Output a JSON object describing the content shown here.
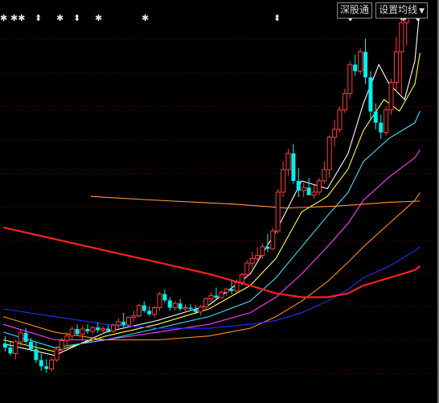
{
  "toolbar": {
    "shenzhen_label": "深股通",
    "set_ma_label": "设置均线",
    "dropdown_icon": "chevron-down-icon"
  },
  "markers": [
    "✱",
    "✱✱",
    "⬍",
    "✱",
    "⬍",
    "✱",
    "✱",
    "⬍",
    "⬍",
    "✱",
    "⬍"
  ],
  "colors": {
    "background": "#000000",
    "up": "#ff3c3c",
    "down": "#00f0f0",
    "ma5": "#ffffff",
    "ma10": "#ffff40",
    "ma20": "#40e0ff",
    "ma30": "#ff40ff",
    "ma60": "#ff8c1a",
    "ma120": "#2030ff",
    "ma250": "#ff2020",
    "avg": "#ff9a40",
    "grid": "#a00000"
  },
  "chart_data": {
    "type": "candlestick",
    "y_axis": {
      "min": 0,
      "max": 100,
      "grid": "dotted"
    },
    "candles": [
      {
        "o": 13,
        "h": 15,
        "l": 11,
        "c": 12
      },
      {
        "o": 12,
        "h": 13.5,
        "l": 10,
        "c": 10.5
      },
      {
        "o": 10.5,
        "h": 14,
        "l": 9,
        "c": 13.5
      },
      {
        "o": 13.5,
        "h": 16.5,
        "l": 12.5,
        "c": 15.8
      },
      {
        "o": 15.8,
        "h": 17,
        "l": 13,
        "c": 13.5
      },
      {
        "o": 13.5,
        "h": 14.5,
        "l": 11,
        "c": 11.6
      },
      {
        "o": 11.6,
        "h": 13.5,
        "l": 8,
        "c": 8.8
      },
      {
        "o": 8.8,
        "h": 10.5,
        "l": 6,
        "c": 7.2
      },
      {
        "o": 7.2,
        "h": 9,
        "l": 5.5,
        "c": 6.5
      },
      {
        "o": 6.5,
        "h": 9.5,
        "l": 5.8,
        "c": 8.8
      },
      {
        "o": 8.8,
        "h": 12,
        "l": 8.3,
        "c": 11.6
      },
      {
        "o": 11.6,
        "h": 14.5,
        "l": 10.5,
        "c": 13.8
      },
      {
        "o": 13.8,
        "h": 16,
        "l": 12.4,
        "c": 15
      },
      {
        "o": 15,
        "h": 17.5,
        "l": 14.2,
        "c": 16.8
      },
      {
        "o": 16.8,
        "h": 18,
        "l": 15,
        "c": 15.5
      },
      {
        "o": 15.5,
        "h": 17.5,
        "l": 14,
        "c": 16.8
      },
      {
        "o": 16.8,
        "h": 18,
        "l": 15.5,
        "c": 16.2
      },
      {
        "o": 16.2,
        "h": 17.5,
        "l": 15.5,
        "c": 17.2
      },
      {
        "o": 17.2,
        "h": 18.5,
        "l": 15.8,
        "c": 16.5
      },
      {
        "o": 16.5,
        "h": 17.5,
        "l": 15.5,
        "c": 16.9
      },
      {
        "o": 16.9,
        "h": 17.8,
        "l": 15.8,
        "c": 16.3
      },
      {
        "o": 16.3,
        "h": 18.2,
        "l": 15.8,
        "c": 17.8
      },
      {
        "o": 17.8,
        "h": 19.5,
        "l": 16.9,
        "c": 18.7
      },
      {
        "o": 18.7,
        "h": 21,
        "l": 17.2,
        "c": 17.8
      },
      {
        "o": 17.8,
        "h": 20,
        "l": 17.2,
        "c": 19.8
      },
      {
        "o": 19.8,
        "h": 21.5,
        "l": 18.7,
        "c": 20.2
      },
      {
        "o": 20.2,
        "h": 23.2,
        "l": 19.8,
        "c": 22.9
      },
      {
        "o": 22.9,
        "h": 24,
        "l": 21,
        "c": 21.5
      },
      {
        "o": 21.5,
        "h": 22.7,
        "l": 20.2,
        "c": 20.6
      },
      {
        "o": 20.6,
        "h": 22.7,
        "l": 19.8,
        "c": 22.3
      },
      {
        "o": 22.3,
        "h": 26.3,
        "l": 21.5,
        "c": 25.8
      },
      {
        "o": 25.8,
        "h": 27,
        "l": 23.5,
        "c": 24.2
      },
      {
        "o": 24.2,
        "h": 25,
        "l": 21.5,
        "c": 22.3
      },
      {
        "o": 22.3,
        "h": 24,
        "l": 21.5,
        "c": 23.4
      },
      {
        "o": 23.4,
        "h": 24.6,
        "l": 21.5,
        "c": 22
      },
      {
        "o": 22,
        "h": 23.2,
        "l": 21,
        "c": 22.3
      },
      {
        "o": 22.3,
        "h": 23.2,
        "l": 21.5,
        "c": 22
      },
      {
        "o": 22,
        "h": 23,
        "l": 20.6,
        "c": 21.2
      },
      {
        "o": 21.2,
        "h": 23,
        "l": 20.2,
        "c": 22.5
      },
      {
        "o": 22.5,
        "h": 25,
        "l": 21.9,
        "c": 24.6
      },
      {
        "o": 24.6,
        "h": 26.3,
        "l": 23.8,
        "c": 25.4
      },
      {
        "o": 25.4,
        "h": 27.5,
        "l": 24.6,
        "c": 24.9
      },
      {
        "o": 24.9,
        "h": 26.8,
        "l": 24.6,
        "c": 26.3
      },
      {
        "o": 26.3,
        "h": 27.5,
        "l": 25.4,
        "c": 27.1
      },
      {
        "o": 27.1,
        "h": 29.2,
        "l": 25.8,
        "c": 26.6
      },
      {
        "o": 26.6,
        "h": 29.6,
        "l": 26.3,
        "c": 28.8
      },
      {
        "o": 28.8,
        "h": 31.3,
        "l": 27.9,
        "c": 30.8
      },
      {
        "o": 30.8,
        "h": 34.6,
        "l": 30,
        "c": 33.8
      },
      {
        "o": 33.8,
        "h": 36.7,
        "l": 32.5,
        "c": 35
      },
      {
        "o": 35,
        "h": 37.9,
        "l": 34.2,
        "c": 35.8
      },
      {
        "o": 35.8,
        "h": 38.8,
        "l": 35,
        "c": 38
      },
      {
        "o": 38,
        "h": 41.3,
        "l": 36.7,
        "c": 37.5
      },
      {
        "o": 37.5,
        "h": 42.9,
        "l": 37.1,
        "c": 42.1
      },
      {
        "o": 42.1,
        "h": 52.9,
        "l": 41.3,
        "c": 52.1
      },
      {
        "o": 52.1,
        "h": 60,
        "l": 50.8,
        "c": 57.9
      },
      {
        "o": 57.9,
        "h": 63.3,
        "l": 56.3,
        "c": 62.1
      },
      {
        "o": 62.1,
        "h": 64.6,
        "l": 54.2,
        "c": 55
      },
      {
        "o": 55,
        "h": 58.3,
        "l": 50.8,
        "c": 52.5
      },
      {
        "o": 52.5,
        "h": 54.6,
        "l": 50.8,
        "c": 53.3
      },
      {
        "o": 53.3,
        "h": 55.8,
        "l": 51.7,
        "c": 51.3
      },
      {
        "o": 51.3,
        "h": 53.8,
        "l": 50.4,
        "c": 52.1
      },
      {
        "o": 52.1,
        "h": 55.8,
        "l": 51.3,
        "c": 55
      },
      {
        "o": 55,
        "h": 60,
        "l": 54.2,
        "c": 57.9
      },
      {
        "o": 57.9,
        "h": 66.7,
        "l": 55.8,
        "c": 66.3
      },
      {
        "o": 66.3,
        "h": 70.8,
        "l": 63.8,
        "c": 68.3
      },
      {
        "o": 68.3,
        "h": 74.2,
        "l": 67.5,
        "c": 73.3
      },
      {
        "o": 73.3,
        "h": 78.8,
        "l": 72.5,
        "c": 77.5
      },
      {
        "o": 77.5,
        "h": 85.8,
        "l": 76.3,
        "c": 85
      },
      {
        "o": 85,
        "h": 87.5,
        "l": 82.1,
        "c": 83.3
      },
      {
        "o": 83.3,
        "h": 89.2,
        "l": 82.5,
        "c": 88.3
      },
      {
        "o": 88.3,
        "h": 91.7,
        "l": 80,
        "c": 81.7
      },
      {
        "o": 81.7,
        "h": 83.3,
        "l": 70.8,
        "c": 72.9
      },
      {
        "o": 72.9,
        "h": 75,
        "l": 68.3,
        "c": 70
      },
      {
        "o": 70,
        "h": 72.1,
        "l": 65.8,
        "c": 67.5
      },
      {
        "o": 67.5,
        "h": 74.2,
        "l": 66.7,
        "c": 73.3
      },
      {
        "o": 73.3,
        "h": 81.3,
        "l": 72.1,
        "c": 80.4
      },
      {
        "o": 80.4,
        "h": 92.1,
        "l": 77.9,
        "c": 88.3
      },
      {
        "o": 88.3,
        "h": 100,
        "l": 77.5,
        "c": 95.8
      },
      {
        "o": 95.8,
        "h": 101,
        "l": 90,
        "c": 100.8
      }
    ],
    "ma_lines": [
      {
        "name": "ma5",
        "points": [
          [
            0,
            13
          ],
          [
            10,
            10
          ],
          [
            20,
            16
          ],
          [
            30,
            19
          ],
          [
            40,
            23
          ],
          [
            48,
            31
          ],
          [
            53,
            42
          ],
          [
            58,
            55
          ],
          [
            63,
            53
          ],
          [
            67,
            62
          ],
          [
            70,
            75
          ],
          [
            73,
            85
          ],
          [
            75,
            80
          ],
          [
            78,
            76
          ],
          [
            80,
            86
          ],
          [
            81,
            100
          ]
        ]
      },
      {
        "name": "ma10",
        "points": [
          [
            0,
            14
          ],
          [
            10,
            11
          ],
          [
            20,
            15
          ],
          [
            30,
            18
          ],
          [
            40,
            22
          ],
          [
            48,
            28
          ],
          [
            53,
            35
          ],
          [
            58,
            47
          ],
          [
            63,
            51
          ],
          [
            67,
            58
          ],
          [
            70,
            68
          ],
          [
            74,
            76
          ],
          [
            77,
            73
          ],
          [
            80,
            80
          ],
          [
            81,
            88
          ]
        ]
      },
      {
        "name": "ma20",
        "points": [
          [
            0,
            16
          ],
          [
            10,
            12
          ],
          [
            20,
            14
          ],
          [
            30,
            17
          ],
          [
            40,
            20
          ],
          [
            48,
            24
          ],
          [
            53,
            30
          ],
          [
            58,
            38
          ],
          [
            63,
            46
          ],
          [
            67,
            52
          ],
          [
            70,
            60
          ],
          [
            75,
            66
          ],
          [
            80,
            70
          ],
          [
            81,
            73
          ]
        ]
      },
      {
        "name": "ma30",
        "points": [
          [
            0,
            18
          ],
          [
            10,
            14
          ],
          [
            20,
            14
          ],
          [
            30,
            16
          ],
          [
            40,
            18
          ],
          [
            48,
            21
          ],
          [
            53,
            25
          ],
          [
            58,
            31
          ],
          [
            63,
            38
          ],
          [
            67,
            44
          ],
          [
            70,
            50
          ],
          [
            75,
            56
          ],
          [
            80,
            61
          ],
          [
            81,
            63
          ]
        ]
      },
      {
        "name": "ma60",
        "points": [
          [
            0,
            20
          ],
          [
            10,
            16
          ],
          [
            20,
            14
          ],
          [
            30,
            14
          ],
          [
            40,
            15
          ],
          [
            48,
            17
          ],
          [
            53,
            20
          ],
          [
            58,
            24
          ],
          [
            63,
            29
          ],
          [
            67,
            34
          ],
          [
            70,
            38
          ],
          [
            75,
            44
          ],
          [
            80,
            50
          ],
          [
            81,
            52
          ]
        ]
      },
      {
        "name": "ma120",
        "points": [
          [
            0,
            22
          ],
          [
            10,
            20
          ],
          [
            20,
            18
          ],
          [
            30,
            17
          ],
          [
            40,
            17
          ],
          [
            48,
            18
          ],
          [
            53,
            19
          ],
          [
            58,
            21
          ],
          [
            63,
            24
          ],
          [
            67,
            27
          ],
          [
            70,
            30
          ],
          [
            75,
            33
          ],
          [
            80,
            37
          ],
          [
            81,
            38
          ]
        ]
      },
      {
        "name": "ma250",
        "points": [
          [
            0,
            43
          ],
          [
            10,
            40
          ],
          [
            20,
            37
          ],
          [
            30,
            34
          ],
          [
            40,
            31
          ],
          [
            48,
            28
          ],
          [
            53,
            26
          ],
          [
            58,
            25
          ],
          [
            63,
            25
          ],
          [
            67,
            26
          ],
          [
            70,
            28
          ],
          [
            75,
            30
          ],
          [
            80,
            32
          ],
          [
            81,
            33
          ]
        ]
      },
      {
        "name": "avg",
        "points": [
          [
            17,
            51
          ],
          [
            30,
            50
          ],
          [
            45,
            49
          ],
          [
            55,
            48
          ],
          [
            65,
            48.5
          ],
          [
            75,
            49.5
          ],
          [
            81,
            49.8
          ]
        ]
      }
    ]
  }
}
